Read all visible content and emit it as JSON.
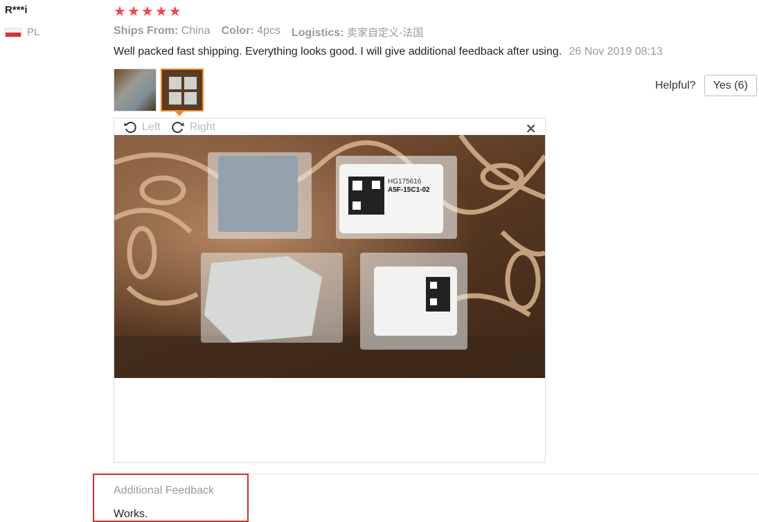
{
  "review": {
    "user_name": "R***i",
    "country": "PL",
    "rating_stars": 5,
    "ships_from_label": "Ships From:",
    "ships_from_value": "China",
    "color_label": "Color:",
    "color_value": "4pcs",
    "logistics_label": "Logistics:",
    "logistics_value": "卖家自定义-法国",
    "text": "Well packed fast shipping. Everything looks good. I will give additional feedback after using.",
    "date": "26 Nov 2019 08:13"
  },
  "helpful": {
    "label": "Helpful?",
    "yes_button": "Yes (6)"
  },
  "viewer": {
    "rotate_left_label": "Left",
    "rotate_right_label": "Right",
    "close_symbol": "×"
  },
  "photo_text": {
    "label_code": "HG175616",
    "label_model": "A5F-15C1-02"
  },
  "additional_feedback": {
    "title": "Additional Feedback",
    "text": "Works."
  },
  "colors": {
    "star": "#f0474b",
    "accent": "#f08a24",
    "highlight_box": "#d12b2b"
  }
}
